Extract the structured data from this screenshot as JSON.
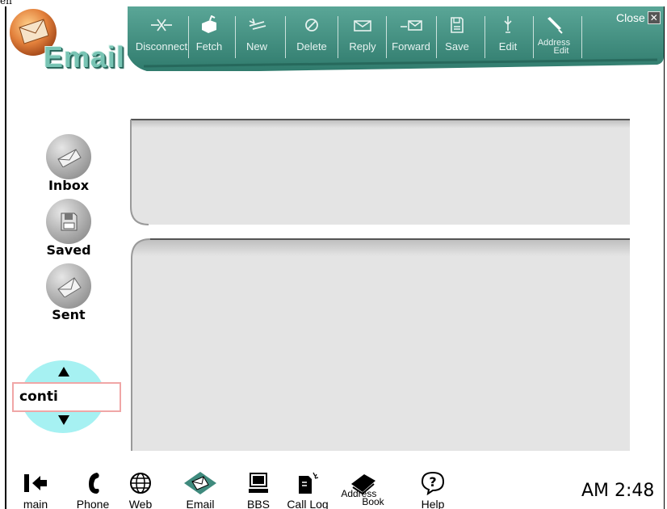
{
  "page_fragment": "en",
  "app": {
    "title": "Email"
  },
  "toolbar": {
    "buttons": [
      {
        "label": "Disconnect",
        "icon": "disconnect-icon"
      },
      {
        "label": "Fetch",
        "icon": "fetch-icon"
      },
      {
        "label": "New",
        "icon": "new-icon"
      },
      {
        "label": "Delete",
        "icon": "delete-icon"
      },
      {
        "label": "Reply",
        "icon": "reply-icon"
      },
      {
        "label": "Forward",
        "icon": "forward-icon"
      },
      {
        "label": "Save",
        "icon": "save-icon"
      },
      {
        "label": "Edit",
        "icon": "edit-icon"
      },
      {
        "label_line1": "Address",
        "label_line2": "Edit",
        "icon": "address-edit-icon"
      }
    ],
    "close_label": "Close",
    "close_glyph": "✕"
  },
  "folders": [
    {
      "label": "Inbox",
      "icon": "inbox-icon"
    },
    {
      "label": "Saved",
      "icon": "saved-icon"
    },
    {
      "label": "Sent",
      "icon": "sent-icon"
    }
  ],
  "scroller": {
    "value": "conti"
  },
  "bottom_nav": [
    {
      "label": "main",
      "icon": "back-arrow-icon"
    },
    {
      "label": "Phone",
      "icon": "phone-icon"
    },
    {
      "label": "Web",
      "icon": "globe-icon"
    },
    {
      "label": "Email",
      "icon": "email-icon"
    },
    {
      "label": "BBS",
      "icon": "computer-icon"
    },
    {
      "label": "Call Log",
      "icon": "call-log-icon"
    },
    {
      "label_line1": "Address",
      "label_line2": "Book",
      "icon": "address-book-icon"
    },
    {
      "label": "Help",
      "icon": "help-icon"
    }
  ],
  "clock": "AM 2:48",
  "colors": {
    "toolbar_teal": "#3f8a7d",
    "panel_gray": "#e4e4e4",
    "scroller_cyan": "#a6f1f2",
    "field_border": "#f0a6a6"
  }
}
